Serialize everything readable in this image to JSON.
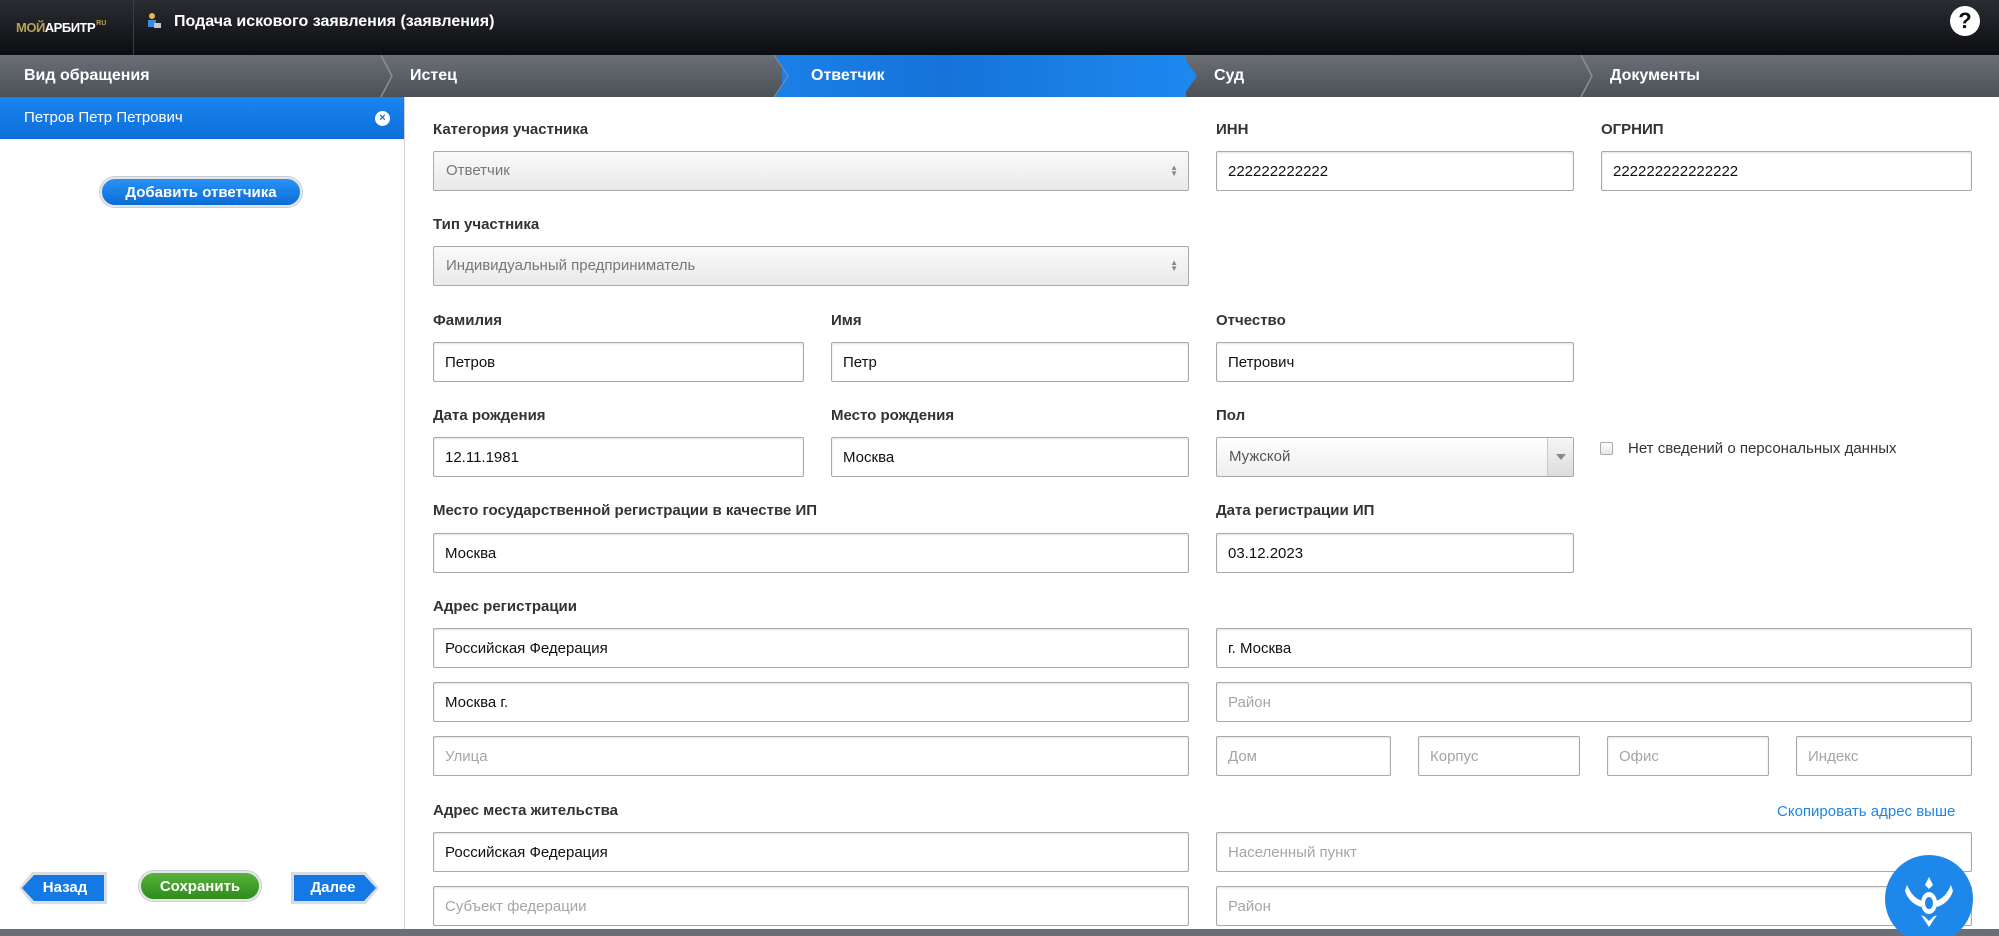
{
  "header": {
    "logo_part1": "МОЙ",
    "logo_part2": "АРБИТР",
    "logo_part3": "RU",
    "title": "Подача искового заявления (заявления)",
    "help_label": "?"
  },
  "steps": [
    {
      "label": "Вид обращения",
      "active": false
    },
    {
      "label": "Истец",
      "active": false
    },
    {
      "label": "Ответчик",
      "active": true
    },
    {
      "label": "Суд",
      "active": false
    },
    {
      "label": "Документы",
      "active": false
    }
  ],
  "sidebar": {
    "selected_item": "Петров Петр Петрович",
    "close_glyph": "×",
    "add_button": "Добавить ответчика",
    "back_button": "Назад",
    "save_button": "Сохранить",
    "next_button": "Далее"
  },
  "form": {
    "category": {
      "label": "Категория участника",
      "value": "Ответчик"
    },
    "inn": {
      "label": "ИНН",
      "value": "222222222222"
    },
    "ogrnip": {
      "label": "ОГРНИП",
      "value": "222222222222222"
    },
    "participant_type": {
      "label": "Тип участника",
      "value": "Индивидуальный предприниматель"
    },
    "surname": {
      "label": "Фамилия",
      "value": "Петров"
    },
    "name": {
      "label": "Имя",
      "value": "Петр"
    },
    "patronymic": {
      "label": "Отчество",
      "value": "Петрович"
    },
    "birth_date": {
      "label": "Дата рождения",
      "value": "12.11.1981"
    },
    "birth_place": {
      "label": "Место рождения",
      "value": "Москва"
    },
    "gender": {
      "label": "Пол",
      "value": "Мужской"
    },
    "no_personal_data": {
      "label": "Нет сведений о персональных данных",
      "checked": false
    },
    "reg_place": {
      "label": "Место государственной регистрации в качестве ИП",
      "value": "Москва"
    },
    "reg_date": {
      "label": "Дата регистрации ИП",
      "value": "03.12.2023"
    },
    "reg_address": {
      "label": "Адрес регистрации",
      "country": "Российская Федерация",
      "city": "г. Москва",
      "region": "Москва г.",
      "district_placeholder": "Район",
      "street_placeholder": "Улица",
      "house_placeholder": "Дом",
      "building_placeholder": "Корпус",
      "office_placeholder": "Офис",
      "index_placeholder": "Индекс"
    },
    "residence_address": {
      "label": "Адрес места жительства",
      "copy_link": "Скопировать адрес выше",
      "country": "Российская Федерация",
      "locality_placeholder": "Населенный пункт",
      "subject_placeholder": "Субъект федерации",
      "district_placeholder": "Район"
    }
  },
  "colors": {
    "accent": "#1b7fe8",
    "save_green": "#3f9d27",
    "header_dark": "#16181c",
    "stepbar_gray": "#5a5e65"
  }
}
